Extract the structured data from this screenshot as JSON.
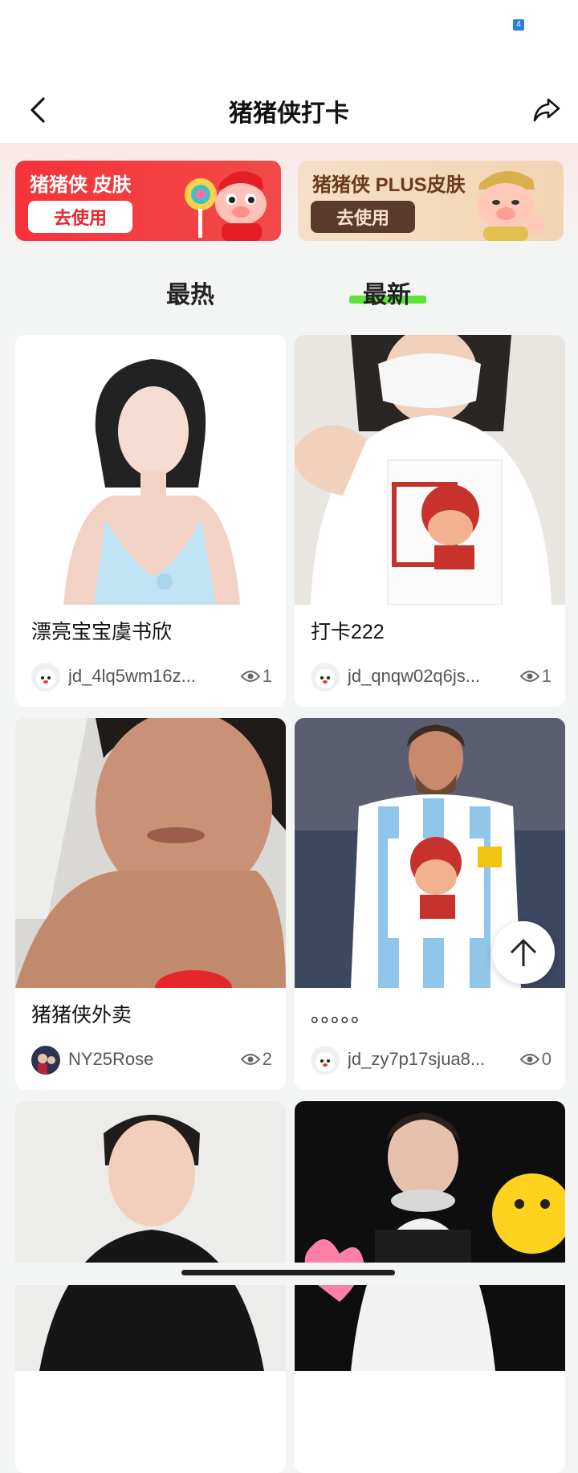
{
  "status_bar": {
    "badge": "4"
  },
  "header": {
    "title": "猪猪侠打卡"
  },
  "banners": [
    {
      "title": "猪猪侠 皮肤",
      "button": "去使用"
    },
    {
      "title": "猪猪侠 PLUS皮肤",
      "button": "去使用"
    }
  ],
  "tabs": {
    "hot": "最热",
    "new": "最新",
    "active": "最新"
  },
  "colors": {
    "accent": "#5fe43a",
    "brand_red": "#f6323a",
    "plus_brown": "#5b3b2c"
  },
  "posts": [
    {
      "title": "漂亮宝宝虞书欣",
      "user": "jd_4lq5wm16z...",
      "views": "1",
      "image": "woman-blue-halter-portrait",
      "avatar": "jd-dog-avatar"
    },
    {
      "title": "打卡222",
      "user": "jd_qnqw02q6js...",
      "views": "1",
      "image": "masked-person-heart-hands-with-pig-mascot-card",
      "avatar": "jd-dog-avatar"
    },
    {
      "title": "猪猪侠外卖",
      "user": "NY25Rose",
      "views": "2",
      "image": "man-close-up-with-red-sign",
      "avatar": "photo-avatar"
    },
    {
      "title": "。。。。。",
      "user": "jd_zy7p17sjua8...",
      "views": "0",
      "image": "footballer-argentina-shirt-with-pig-mascot",
      "avatar": "jd-dog-avatar"
    },
    {
      "title": "",
      "user": "",
      "views": "",
      "image": "man-black-tshirt-portrait",
      "avatar": ""
    },
    {
      "title": "",
      "user": "",
      "views": "",
      "image": "singer-with-headphones-and-smiley",
      "avatar": ""
    }
  ]
}
